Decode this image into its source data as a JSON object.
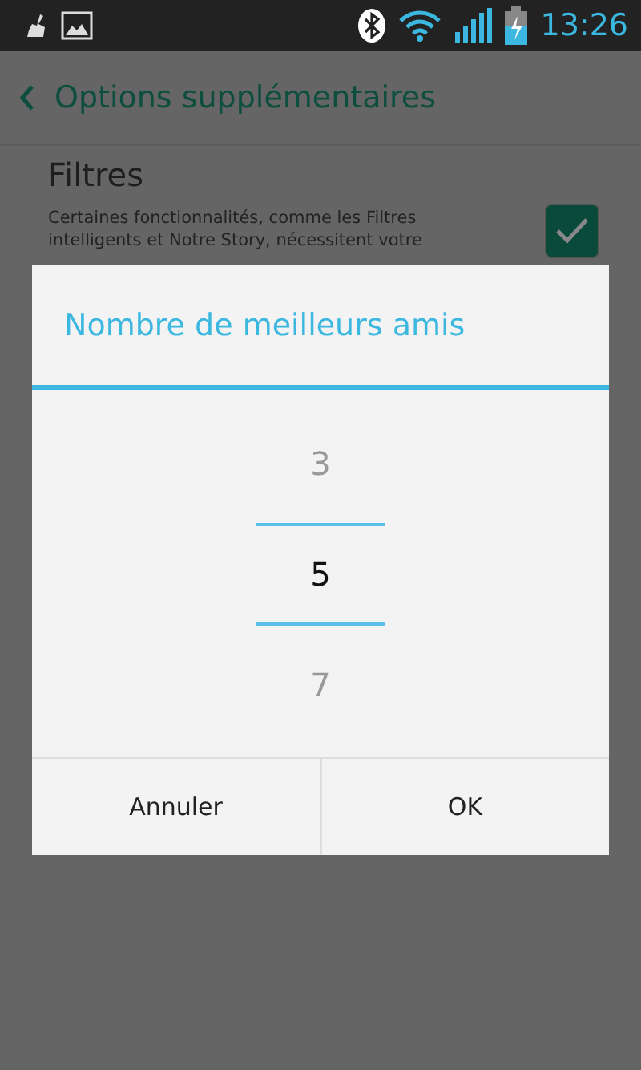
{
  "status_bar": {
    "time": "13:26"
  },
  "header": {
    "title": "Options supplémentaires"
  },
  "setting": {
    "title": "Filtres",
    "description": "Certaines fonctionnalités, comme les Filtres intelligents et Notre Story, nécessitent votre",
    "checked": true
  },
  "dialog": {
    "title": "Nombre de meilleurs amis",
    "picker": [
      {
        "value": "3",
        "selected": false
      },
      {
        "value": "5",
        "selected": true
      },
      {
        "value": "7",
        "selected": false
      }
    ],
    "buttons": [
      "Annuler",
      "OK"
    ]
  }
}
